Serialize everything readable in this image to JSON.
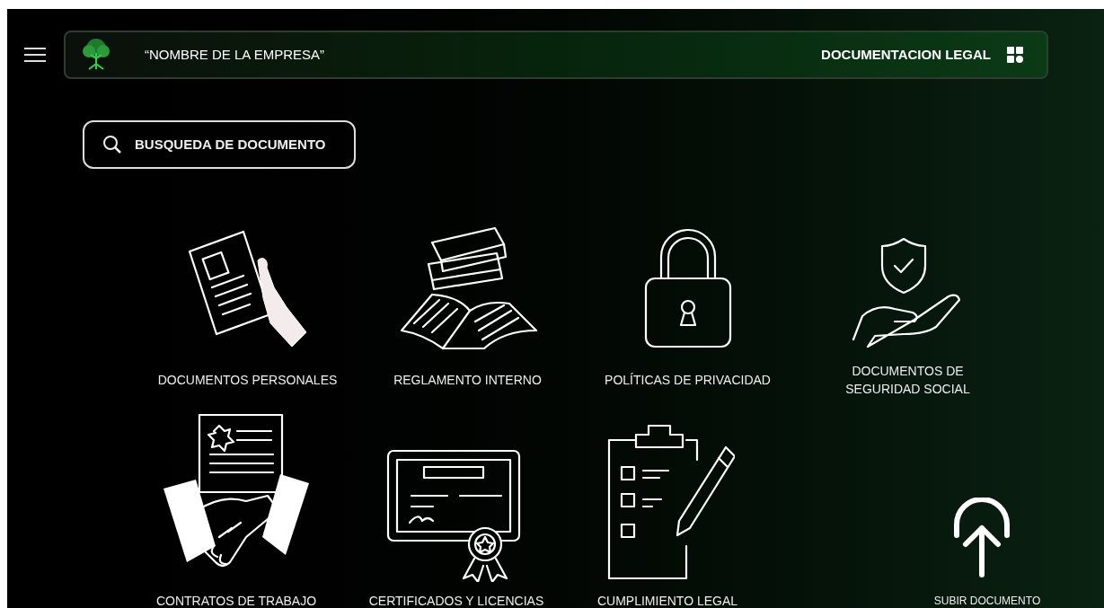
{
  "header": {
    "company_name": "“NOMBRE DE LA EMPRESA”",
    "section_title": "DOCUMENTACION LEGAL"
  },
  "search": {
    "label": "BUSQUEDA DE DOCUMENTO"
  },
  "rows": [
    {
      "tiles": [
        {
          "kind": "personal",
          "label": "DOCUMENTOS PERSONALES"
        },
        {
          "kind": "books",
          "label": "REGLAMENTO INTERNO"
        },
        {
          "kind": "lock",
          "label": "POLÍTICAS DE PRIVACIDAD"
        },
        {
          "kind": "shield",
          "label": "DOCUMENTOS DE SEGURIDAD SOCIAL"
        }
      ]
    },
    {
      "tiles": [
        {
          "kind": "contract",
          "label": "CONTRATOS DE TRABAJO"
        },
        {
          "kind": "certificate",
          "label": "CERTIFICADOS Y LICENCIAS"
        },
        {
          "kind": "clipboard",
          "label": "CUMPLIMIENTO LEGAL"
        }
      ]
    }
  ],
  "upload": {
    "label": "SUBIR DOCUMENTO"
  }
}
